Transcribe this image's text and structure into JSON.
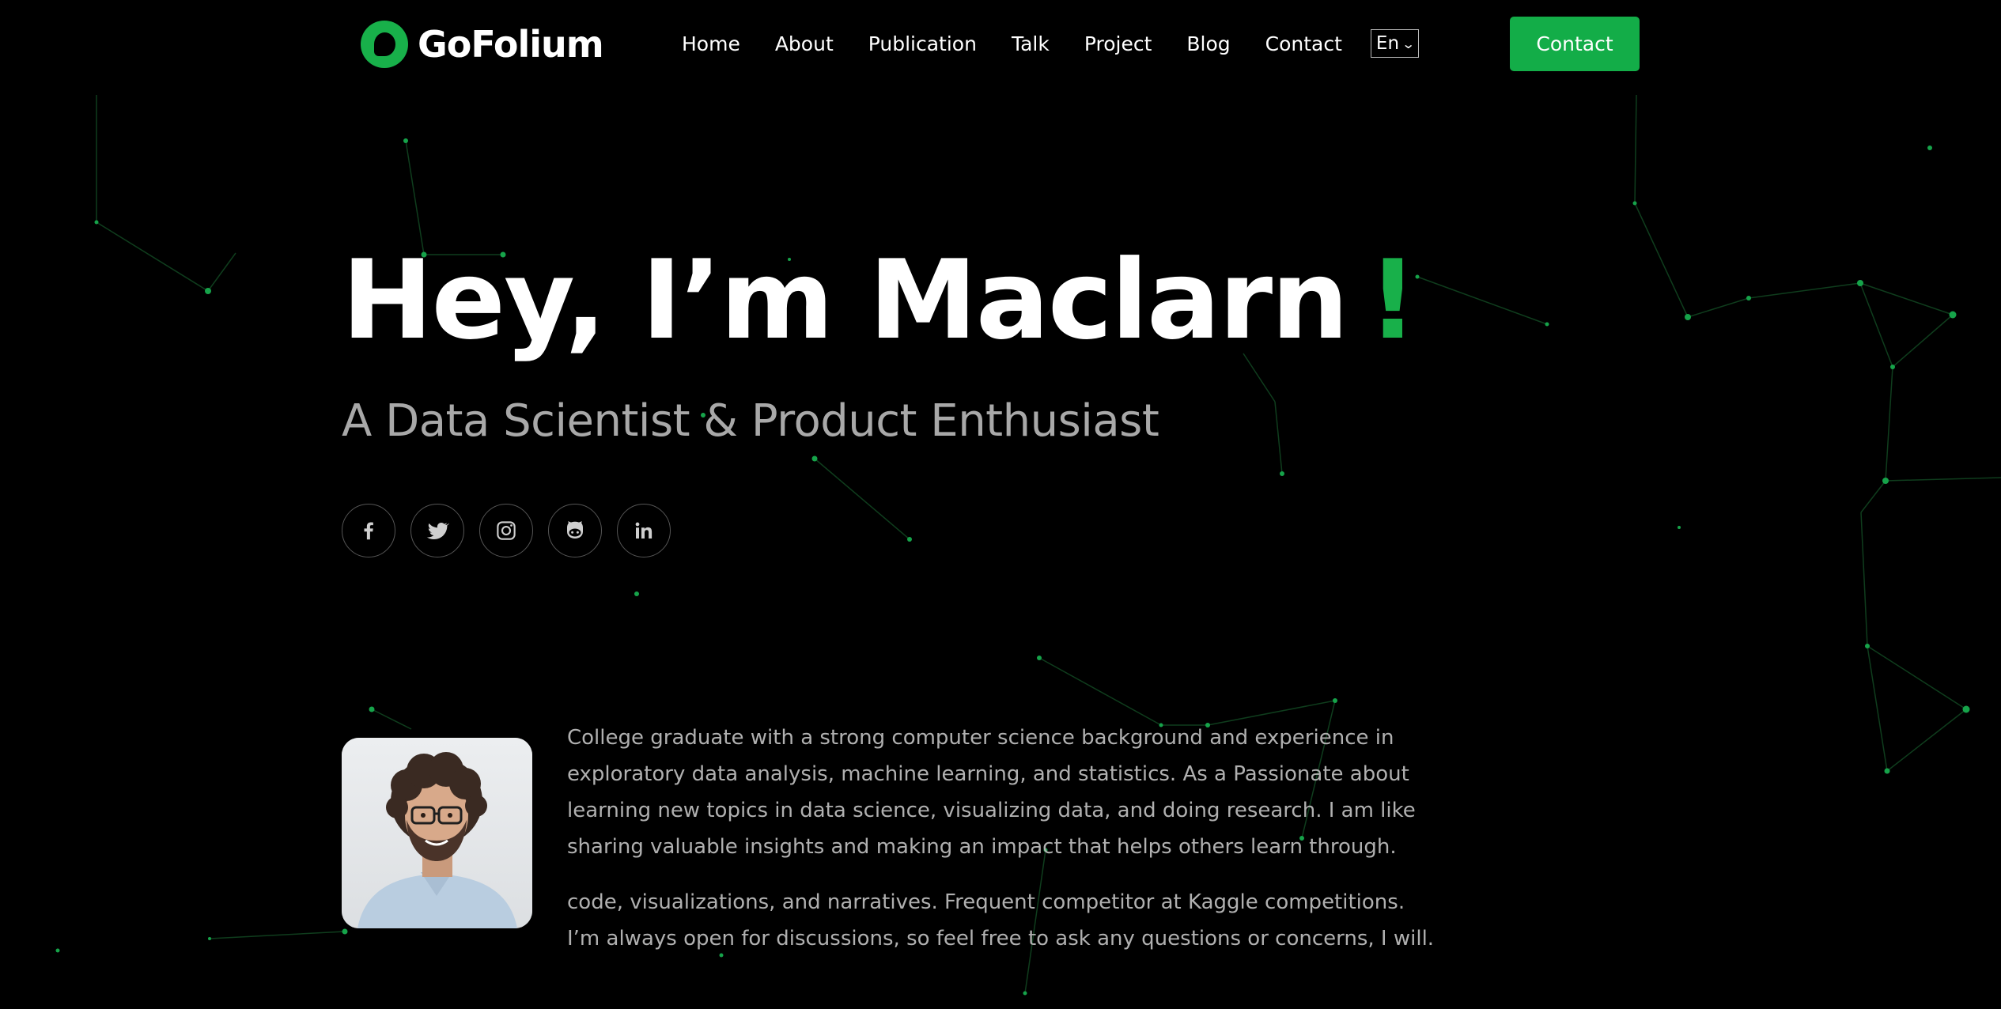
{
  "brand": {
    "name": "GoFolium",
    "accent_color": "#18b04a",
    "button_color": "#13ad48",
    "background": "#000000"
  },
  "nav": {
    "items": [
      {
        "label": "Home"
      },
      {
        "label": "About"
      },
      {
        "label": "Publication"
      },
      {
        "label": "Talk"
      },
      {
        "label": "Project"
      },
      {
        "label": "Blog"
      },
      {
        "label": "Contact"
      }
    ],
    "language": {
      "selected": "En",
      "icon": "chevron-down-icon"
    },
    "cta_label": "Contact"
  },
  "hero": {
    "title": "Hey, I’m Maclarn",
    "exclamation": "!",
    "subtitle": "A Data Scientist & Product Enthusiast",
    "socials": [
      {
        "icon": "facebook-icon"
      },
      {
        "icon": "twitter-icon"
      },
      {
        "icon": "instagram-icon"
      },
      {
        "icon": "github-icon"
      },
      {
        "icon": "linkedin-icon"
      }
    ]
  },
  "about": {
    "paragraphs": [
      "College graduate with a strong computer science background and experience in exploratory data analysis, machine learning, and statistics. As a Passionate about learning new topics in data science, visualizing data, and doing research. I am like sharing valuable insights and making an impact that helps others learn through.",
      "code, visualizations, and narratives. Frequent competitor at Kaggle competitions. I’m always open for discussions, so feel free to ask any questions or concerns, I will."
    ]
  }
}
